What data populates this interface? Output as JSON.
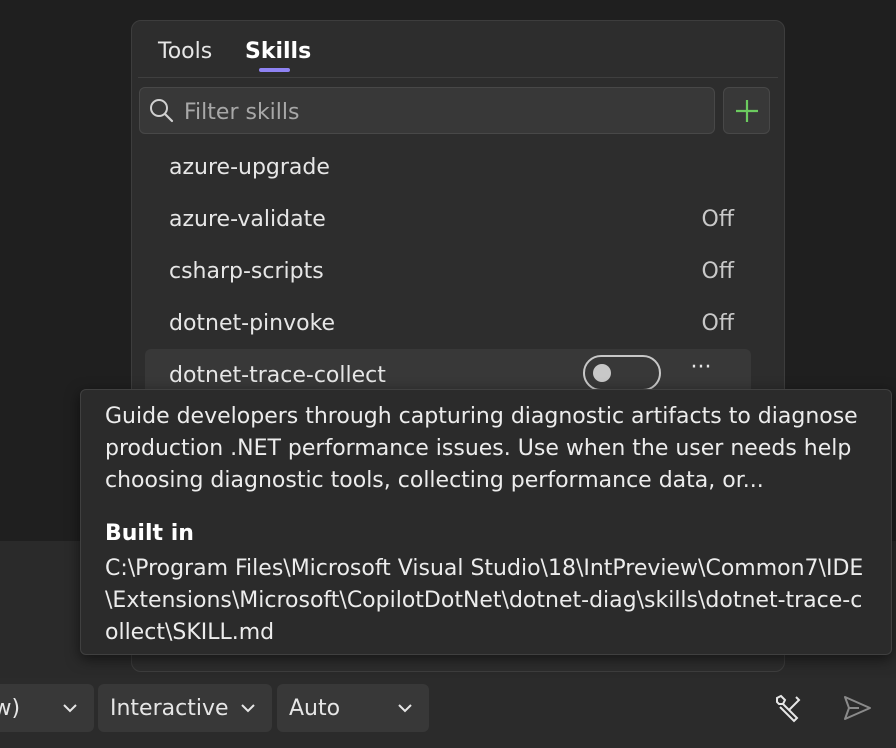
{
  "tabs": [
    {
      "label": "Tools",
      "selected": false
    },
    {
      "label": "Skills",
      "selected": true
    }
  ],
  "accent_color": "#8f83f3",
  "add_color": "#6ccb5f",
  "search": {
    "placeholder": "Filter skills",
    "value": ""
  },
  "skills": [
    {
      "name": "azure-upgrade",
      "status": ""
    },
    {
      "name": "azure-validate",
      "status": "Off"
    },
    {
      "name": "csharp-scripts",
      "status": "Off"
    },
    {
      "name": "dotnet-pinvoke",
      "status": "Off"
    },
    {
      "name": "dotnet-trace-collect",
      "status": "",
      "toggle_on": false,
      "more_label": "···"
    }
  ],
  "tooltip": {
    "description": "Guide developers through capturing diagnostic artifacts to diagnose production .NET performance issues. Use when the user needs help choosing diagnostic tools, collecting performance data, or...",
    "source_label": "Built in",
    "path": "C:\\Program Files\\Microsoft Visual Studio\\18\\IntPreview\\Common7\\IDE\\Extensions\\Microsoft\\CopilotDotNet\\dotnet-diag\\skills\\dotnet-trace-collect\\SKILL.md"
  },
  "bottom_bar": {
    "mode_label": "ew)",
    "agent_mode_label": "Interactive",
    "model_label": "Auto",
    "tools_icon": "wrench-screwdriver-icon",
    "send_icon": "send-icon"
  }
}
